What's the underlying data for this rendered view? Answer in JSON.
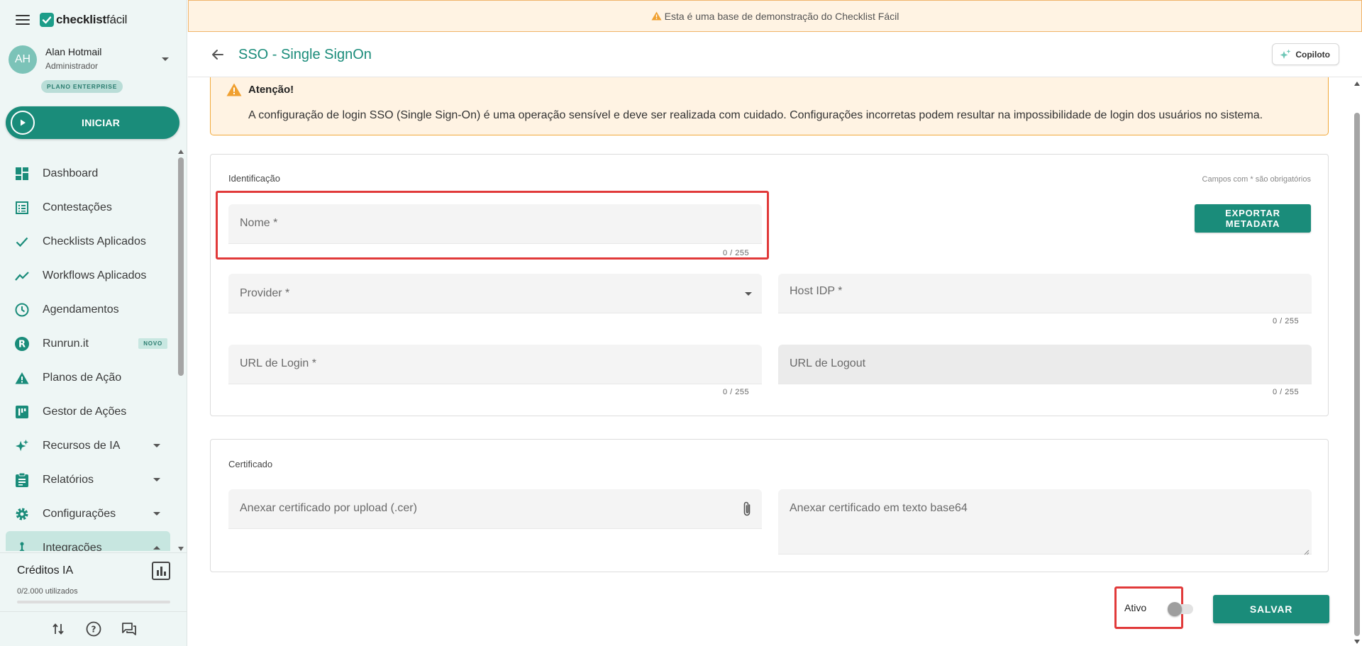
{
  "app": {
    "logo_bold": "checklist",
    "logo_light": "fácil"
  },
  "user": {
    "initials": "AH",
    "name": "Alan Hotmail",
    "role": "Administrador",
    "plan": "PLANO ENTERPRISE"
  },
  "sidebar": {
    "start_label": "INICIAR",
    "items": [
      {
        "label": "Dashboard",
        "icon": "dashboard-icon"
      },
      {
        "label": "Contestações",
        "icon": "list-icon"
      },
      {
        "label": "Checklists Aplicados",
        "icon": "check-icon"
      },
      {
        "label": "Workflows Aplicados",
        "icon": "trending-icon"
      },
      {
        "label": "Agendamentos",
        "icon": "clock-icon"
      },
      {
        "label": "Runrun.it",
        "icon": "runrunit-icon",
        "badge": "NOVO"
      },
      {
        "label": "Planos de Ação",
        "icon": "warning-icon"
      },
      {
        "label": "Gestor de Ações",
        "icon": "kanban-icon"
      },
      {
        "label": "Recursos de IA",
        "icon": "sparkles-icon"
      },
      {
        "label": "Relatórios",
        "icon": "clipboard-icon"
      },
      {
        "label": "Configurações",
        "icon": "gear-icon"
      },
      {
        "label": "Integrações",
        "icon": "integration-icon"
      }
    ],
    "credits": {
      "title": "Créditos IA",
      "used": "0/2.000 utilizados",
      "fraction": 0
    }
  },
  "banner": {
    "text": "Esta é uma base de demonstração do Checklist Fácil"
  },
  "header": {
    "title": "SSO - Single SignOn",
    "copilot_label": "Copiloto"
  },
  "alert": {
    "title": "Atenção!",
    "text": "A configuração de login SSO (Single Sign-On) é uma operação sensível e deve ser realizada com cuidado. Configurações incorretas podem resultar na impossibilidade de login dos usuários no sistema."
  },
  "identification": {
    "section_label": "Identificação",
    "required_note": "Campos com * são obrigatórios",
    "nome": {
      "label": "Nome *",
      "counter": "0 / 255"
    },
    "export_label": "EXPORTAR METADATA",
    "provider": {
      "label": "Provider *"
    },
    "host_idp": {
      "label": "Host IDP *",
      "counter": "0 / 255"
    },
    "url_login": {
      "label": "URL de Login *",
      "counter": "0 / 255"
    },
    "url_logout": {
      "label": "URL de Logout",
      "counter": "0 / 255"
    }
  },
  "certificate": {
    "section_label": "Certificado",
    "upload": {
      "label": "Anexar certificado por upload (.cer)"
    },
    "base64": {
      "label": "Anexar certificado em texto base64"
    }
  },
  "footer": {
    "active_label": "Ativo",
    "active": false,
    "save_label": "SALVAR"
  },
  "colors": {
    "primary": "#1a8c7a",
    "warning": "#f2a93b",
    "highlight": "#e13a3a"
  }
}
